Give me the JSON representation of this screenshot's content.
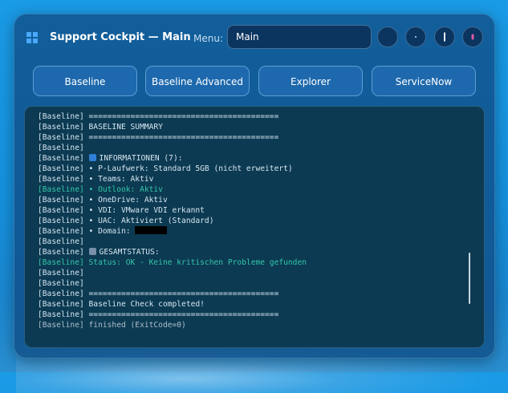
{
  "header": {
    "title": "Support Cockpit — Main",
    "menu_label": "Menu:",
    "menu_value": "Main"
  },
  "buttons": [
    {
      "label": "Baseline"
    },
    {
      "label": "Baseline Advanced"
    },
    {
      "label": "Explorer"
    },
    {
      "label": "ServiceNow"
    }
  ],
  "console": {
    "lines": [
      {
        "text": "[Baseline] =========================================",
        "style": "normal"
      },
      {
        "text": "[Baseline] BASELINE SUMMARY",
        "style": "normal"
      },
      {
        "text": "[Baseline] =========================================",
        "style": "normal"
      },
      {
        "text": "[Baseline]",
        "style": "normal"
      },
      {
        "prefix": "[Baseline] ",
        "icon": "info-icon",
        "text": "INFORMATIONEN (7):",
        "style": "normal"
      },
      {
        "text": "[Baseline] • P-Laufwerk: Standard 5GB (nicht erweitert)",
        "style": "normal"
      },
      {
        "text": "[Baseline] • Teams: Aktiv",
        "style": "normal"
      },
      {
        "text": "[Baseline] • Outlook: Aktiv",
        "style": "hi"
      },
      {
        "text": "[Baseline] • OneDrive: Aktiv",
        "style": "normal"
      },
      {
        "text": "[Baseline] • VDI: VMware VDI erkannt",
        "style": "normal"
      },
      {
        "text": "[Baseline] • UAC: Aktiviert (Standard)",
        "style": "normal"
      },
      {
        "prefix": "[Baseline] ",
        "text": "• Domain: ",
        "redacted": true,
        "style": "normal"
      },
      {
        "text": "[Baseline]",
        "style": "normal"
      },
      {
        "prefix": "[Baseline] ",
        "icon": "chart-icon",
        "text": "GESAMTSTATUS:",
        "style": "normal"
      },
      {
        "text": "[Baseline] Status: OK - Keine kritischen Probleme gefunden",
        "style": "hi"
      },
      {
        "text": "[Baseline]",
        "style": "normal"
      },
      {
        "text": "[Baseline]",
        "style": "normal"
      },
      {
        "text": "[Baseline] =========================================",
        "style": "normal"
      },
      {
        "text": "[Baseline] Baseline Check completed!",
        "style": "normal"
      },
      {
        "text": "[Baseline] =========================================",
        "style": "normal"
      },
      {
        "text": "[Baseline] finished (ExitCode=0)",
        "style": "dim"
      }
    ]
  },
  "colors": {
    "accent_green": "#34c6a8",
    "console_bg": "#0c3a52"
  }
}
